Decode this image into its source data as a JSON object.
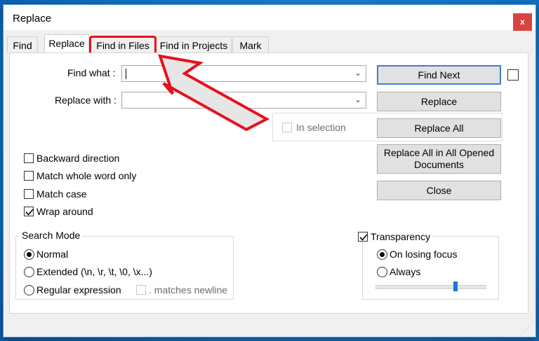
{
  "window": {
    "title": "Replace",
    "close_label": "x"
  },
  "tabs": [
    {
      "label": "Find"
    },
    {
      "label": "Replace"
    },
    {
      "label": "Find in Files"
    },
    {
      "label": "Find in Projects"
    },
    {
      "label": "Mark"
    }
  ],
  "find": {
    "label": "Find what :",
    "value": ""
  },
  "replace": {
    "label": "Replace with :",
    "value": ""
  },
  "buttons": {
    "find_next": "Find Next",
    "replace": "Replace",
    "replace_all": "Replace All",
    "replace_all_opened": "Replace All in All Opened Documents",
    "close": "Close"
  },
  "in_selection": {
    "label": "In selection",
    "checked": false,
    "enabled": false
  },
  "options": [
    {
      "label": "Backward direction",
      "checked": false
    },
    {
      "label": "Match whole word only",
      "checked": false
    },
    {
      "label": "Match case",
      "checked": false
    },
    {
      "label": "Wrap around",
      "checked": true
    }
  ],
  "search_mode": {
    "title": "Search Mode",
    "options": [
      {
        "label": "Normal",
        "selected": true
      },
      {
        "label": "Extended (\\n, \\r, \\t, \\0, \\x...)",
        "selected": false
      },
      {
        "label": "Regular expression",
        "selected": false
      }
    ],
    "matches_newline": ". matches newline"
  },
  "transparency": {
    "label": "Transparency",
    "checked": true,
    "options": [
      {
        "label": "On losing focus",
        "selected": true
      },
      {
        "label": "Always",
        "selected": false
      }
    ],
    "slider_level": 0.7
  },
  "annotation": {
    "arrow_color": "#e8101d",
    "arrow_fill": "#e6e6e6"
  }
}
